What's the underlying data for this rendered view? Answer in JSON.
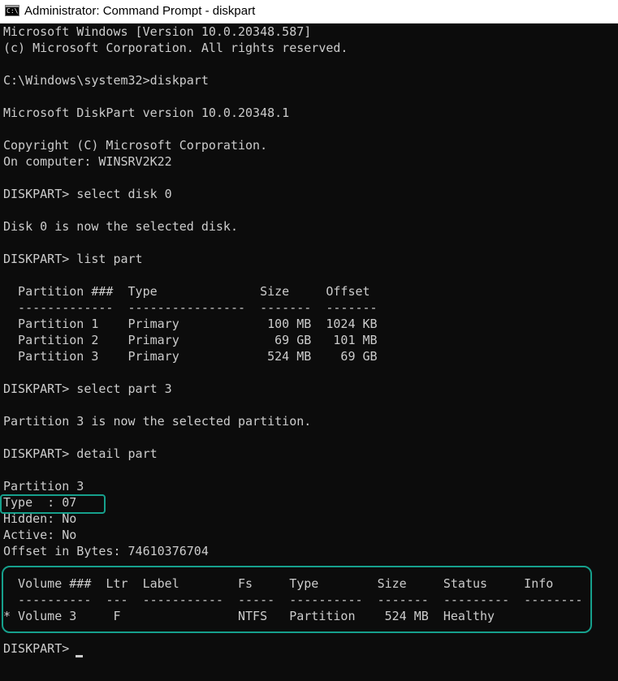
{
  "window": {
    "title": "Administrator: Command Prompt - diskpart",
    "icon": "console-icon",
    "icon_text": "C:\\."
  },
  "console": {
    "lines": [
      "Microsoft Windows [Version 10.0.20348.587]",
      "(c) Microsoft Corporation. All rights reserved.",
      "",
      "C:\\Windows\\system32>diskpart",
      "",
      "Microsoft DiskPart version 10.0.20348.1",
      "",
      "Copyright (C) Microsoft Corporation.",
      "On computer: WINSRV2K22",
      "",
      "DISKPART> select disk 0",
      "",
      "Disk 0 is now the selected disk.",
      "",
      "DISKPART> list part",
      "",
      "  Partition ###  Type              Size     Offset",
      "  -------------  ----------------  -------  -------",
      "  Partition 1    Primary            100 MB  1024 KB",
      "  Partition 2    Primary             69 GB   101 MB",
      "  Partition 3    Primary            524 MB    69 GB",
      "",
      "DISKPART> select part 3",
      "",
      "Partition 3 is now the selected partition.",
      "",
      "DISKPART> detail part",
      "",
      "Partition 3",
      "Type  : 07",
      "Hidden: No",
      "Active: No",
      "Offset in Bytes: 74610376704",
      "",
      "  Volume ###  Ltr  Label        Fs     Type        Size     Status     Info",
      "  ----------  ---  -----------  -----  ----------  -------  ---------  --------",
      "* Volume 3     F                NTFS   Partition    524 MB  Healthy",
      "",
      "DISKPART> "
    ]
  },
  "colors": {
    "console_background": "#0c0c0c",
    "console_text": "#cccccc",
    "highlight": "#16a08c",
    "titlebar_background": "#ffffff"
  }
}
